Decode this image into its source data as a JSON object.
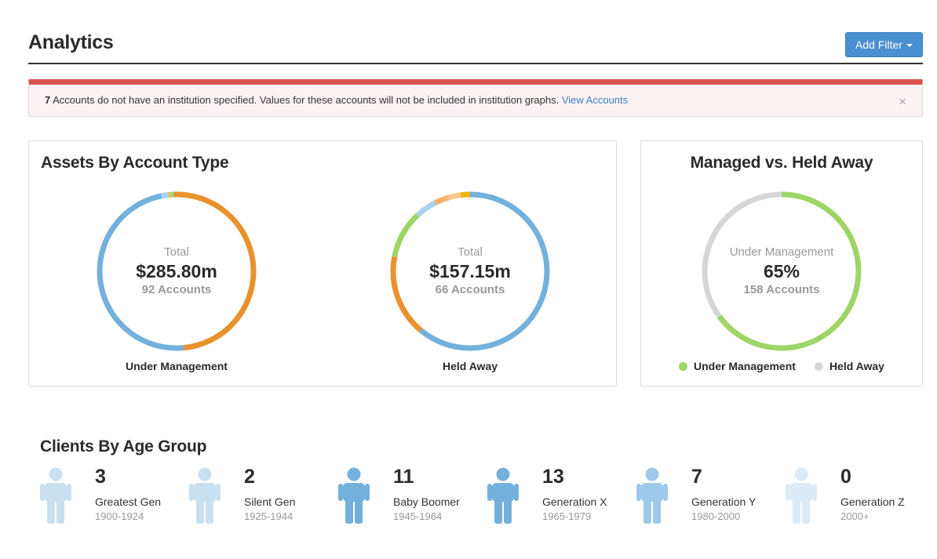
{
  "header": {
    "title": "Analytics",
    "add_filter_label": "Add Filter"
  },
  "alert": {
    "count": "7",
    "message": " Accounts do not have an institution specified. Values for these accounts will not be included in institution graphs. ",
    "link_label": "View Accounts",
    "close_label": "×"
  },
  "assets_panel": {
    "title": "Assets By Account Type",
    "charts": [
      {
        "label": "Total",
        "value": "$285.80m",
        "sub": "92 Accounts",
        "caption": "Under Management",
        "segments": [
          {
            "value": 48.5,
            "color": "#e8922e"
          },
          {
            "value": 48.3,
            "color": "#74b0dc"
          },
          {
            "value": 1.4,
            "color": "#a9d3ef"
          },
          {
            "value": 0.5,
            "color": "#f6b26b"
          },
          {
            "value": 0.7,
            "color": "#9ed567"
          },
          {
            "value": 0.6,
            "color": "#e8922e"
          }
        ]
      },
      {
        "label": "Total",
        "value": "$157.15m",
        "sub": "66 Accounts",
        "caption": "Held Away",
        "segments": [
          {
            "value": 61.0,
            "color": "#74b0dc"
          },
          {
            "value": 17.0,
            "color": "#e8922e"
          },
          {
            "value": 10.0,
            "color": "#9ed567"
          },
          {
            "value": 4.5,
            "color": "#a9d3ef"
          },
          {
            "value": 3.0,
            "color": "#f6b26b"
          },
          {
            "value": 2.5,
            "color": "#f8c891"
          },
          {
            "value": 2.0,
            "color": "#f0b400"
          }
        ]
      }
    ]
  },
  "managed_panel": {
    "title": "Managed vs. Held Away",
    "label": "Under Management",
    "value": "65%",
    "sub": "158 Accounts",
    "segments": [
      {
        "value": 65,
        "color": "#9ed567"
      },
      {
        "value": 35,
        "color": "#d6d6d6"
      }
    ],
    "legend": [
      {
        "label": "Under Management",
        "color": "#9ed567"
      },
      {
        "label": "Held Away",
        "color": "#d6d6d6"
      }
    ]
  },
  "age_section": {
    "title": "Clients By Age Group",
    "groups": [
      {
        "count": "3",
        "name": "Greatest Gen",
        "range": "1900-1924",
        "color": "#c9e0f1"
      },
      {
        "count": "2",
        "name": "Silent Gen",
        "range": "1925-1944",
        "color": "#c9e0f1"
      },
      {
        "count": "11",
        "name": "Baby Boomer",
        "range": "1945-1964",
        "color": "#74b0dc"
      },
      {
        "count": "13",
        "name": "Generation X",
        "range": "1965-1979",
        "color": "#74b0dc"
      },
      {
        "count": "7",
        "name": "Generation Y",
        "range": "1980-2000",
        "color": "#9fc9e8"
      },
      {
        "count": "0",
        "name": "Generation Z",
        "range": "2000+",
        "color": "#dcebf6"
      }
    ]
  }
}
